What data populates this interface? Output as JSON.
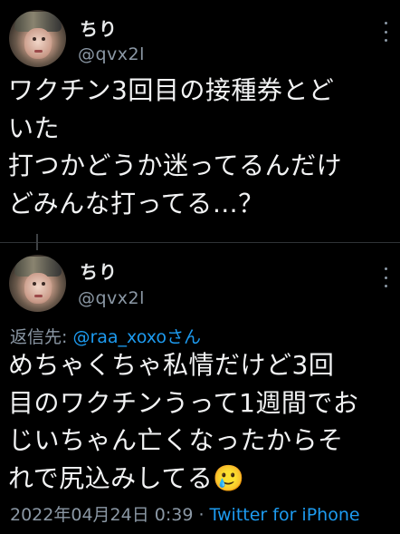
{
  "tweets": [
    {
      "display_name": "ちり",
      "handle": "@qvx2l",
      "text": "ワクチン3回目の接種券とど\nいた\n打つかどうか迷ってるんだけ\nどみんな打ってる…？"
    },
    {
      "display_name": "ちり",
      "handle": "@qvx2l",
      "reply_prefix": "返信先: ",
      "reply_mention": "@raa_xoxoさん",
      "text": "めちゃくちゃ私情だけど3回\n目のワクチンうって1週間でお\nじいちゃん亡くなったからそ\nれで尻込みしてる🥲",
      "timestamp": "2022年04月24日 0:39",
      "separator": " · ",
      "source": "Twitter for iPhone"
    }
  ],
  "icons": {
    "more": "more-vertical-icon",
    "avatar": "user-avatar"
  },
  "colors": {
    "background": "#000000",
    "text": "#e7e9ea",
    "secondary": "#8b98a5",
    "link": "#1d9bf0"
  }
}
